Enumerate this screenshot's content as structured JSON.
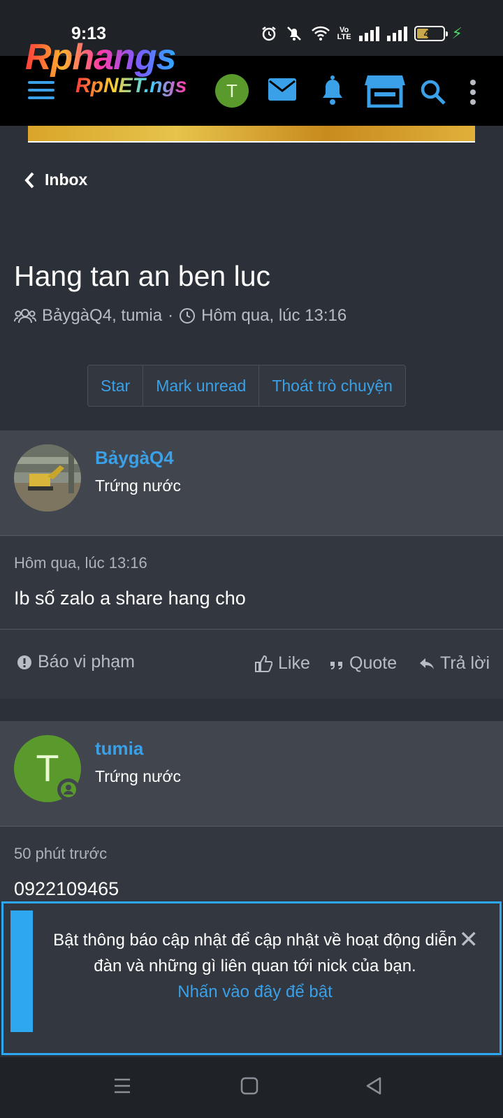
{
  "status_bar": {
    "time": "9:13",
    "volte": "Vo\nLTE",
    "battery": "43"
  },
  "header": {
    "logo_text": "Rphangs",
    "logo_small_text": "RpNET.ngs",
    "avatar_letter": "T",
    "icons": [
      "menu-icon",
      "mail-icon",
      "bell-icon",
      "store-icon",
      "search-icon",
      "more-vert-icon"
    ],
    "accent_color": "#3aa0e8"
  },
  "back": {
    "label": "Inbox"
  },
  "conversation": {
    "title": "Hang tan an ben luc",
    "participants": "BảygàQ4, tumia",
    "separator": "·",
    "time": "Hôm qua, lúc 13:16"
  },
  "buttons": {
    "star": "Star",
    "mark_unread": "Mark unread",
    "leave": "Thoát trò chuyện"
  },
  "messages": [
    {
      "username": "BảygàQ4",
      "user_title": "Trứng nước",
      "time": "Hôm qua, lúc 13:16",
      "text": "Ib số zalo a share hang cho",
      "actions": {
        "report": "Báo vi phạm",
        "like": "Like",
        "quote": "Quote",
        "reply": "Trả lời"
      }
    },
    {
      "username": "tumia",
      "avatar_letter": "T",
      "user_title": "Trứng nước",
      "time": "50 phút trước",
      "text": "0922109465"
    }
  ],
  "notice": {
    "text": "Bật thông báo cập nhật để cập nhật về hoạt động diễn đàn và những gì liên quan tới nick của bạn.",
    "link": "Nhấn vào đây để bật"
  }
}
